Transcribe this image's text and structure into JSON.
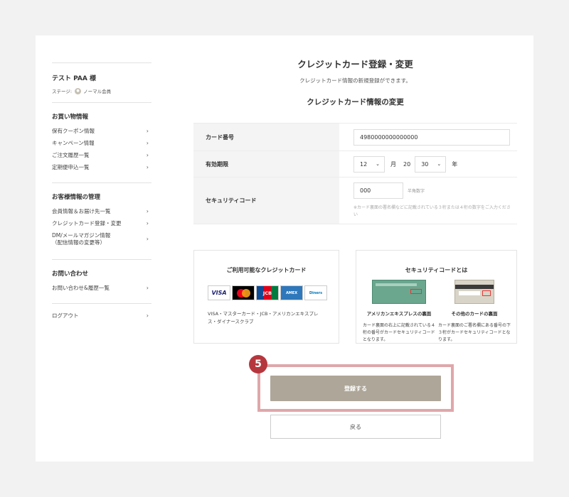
{
  "sidebar": {
    "user_name": "テスト PAA 様",
    "stage_label": "ステージ:",
    "stage_value": "ノーマル会員",
    "sections": [
      {
        "title": "お買い物情報",
        "items": [
          "保有クーポン情報",
          "キャンペーン情報",
          "ご注文履歴一覧",
          "定期便申込一覧"
        ]
      },
      {
        "title": "お客様情報の管理",
        "items": [
          "会員情報＆お届け先一覧",
          "クレジットカード登録・変更",
          "DM/メールマガジン情報",
          "（配信情報の変更等）"
        ]
      },
      {
        "title": "お問い合わせ",
        "items": [
          "お問い合わせ&履歴一覧"
        ]
      }
    ],
    "logout": "ログアウト",
    "chevron": "›"
  },
  "main": {
    "title": "クレジットカード登録・変更",
    "description": "クレジットカード情報の新規登録ができます。",
    "subtitle": "クレジットカード情報の変更"
  },
  "form": {
    "card_number_label": "カード番号",
    "card_number_value": "4980000000000000",
    "expiry_label": "有効期限",
    "expiry_month": "12",
    "month_unit": "月",
    "year_prefix": "20",
    "expiry_year": "30",
    "year_unit": "年",
    "cvv_label": "セキュリティコード",
    "cvv_value": "000",
    "cvv_hint": "半角数字",
    "cvv_note": "※カード裏面の署名欄などに記載されている３桁または４桁の数字をご入力ください",
    "select_chevron": "⌄"
  },
  "cards_box": {
    "title": "ご利用可能なクレジットカード",
    "logos": [
      "VISA",
      "mastercard",
      "JCB",
      "AMERICAN EXPRESS",
      "Diners Club"
    ],
    "text": "VISA・マスターカード・JCB・アメリカンエキスプレス・ダイナースクラブ"
  },
  "security_box": {
    "title": "セキュリティコードとは",
    "amex_title": "アメリカンエキスプレスの裏面",
    "amex_text": "カード裏面の右上に記載されている４桁の番号がカードセキュリティコードとなります。",
    "other_title": "その他のカードの裏面",
    "other_text": "カード裏面のご署名欄にある番号の下３桁がカードセキュリティコードとなります。"
  },
  "step_number": "5",
  "submit_label": "登録する",
  "back_label": "戻る",
  "colors": {
    "submit_bg": "#aea698",
    "highlight_border": "#dfa7aa",
    "badge": "#b5373d"
  }
}
